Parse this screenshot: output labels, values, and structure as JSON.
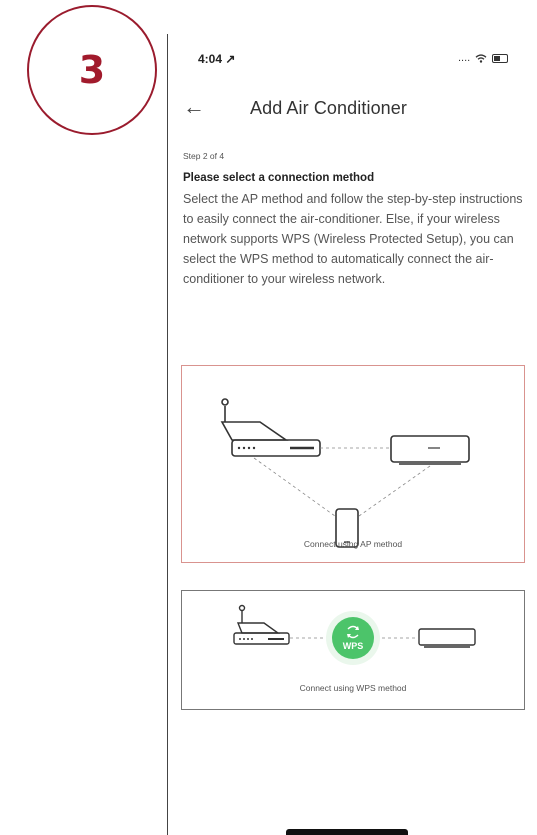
{
  "step_badge": "3",
  "status_bar": {
    "time": "4:04 ↗",
    "signal": "....",
    "wifi_icon": "wifi-icon",
    "battery_icon": "battery-icon"
  },
  "header": {
    "back_icon": "back-arrow-icon",
    "back_glyph": "←",
    "title": "Add Air Conditioner"
  },
  "step_label": "Step 2 of 4",
  "heading": "Please select a connection method",
  "description": "Select the AP method and follow the step-by-step instructions to easily connect the air-conditioner. Else, if your wireless network supports WPS (Wireless Protected Setup), you can select the WPS method to automatically connect the air-conditioner to your wireless network.",
  "options": {
    "ap": {
      "label": "Connect using AP method"
    },
    "wps": {
      "label": "Connect using WPS method",
      "badge": "WPS"
    }
  },
  "colors": {
    "badge": "#a11a2c",
    "wps_green": "#4cc46a",
    "ap_border": "#d9938f"
  }
}
